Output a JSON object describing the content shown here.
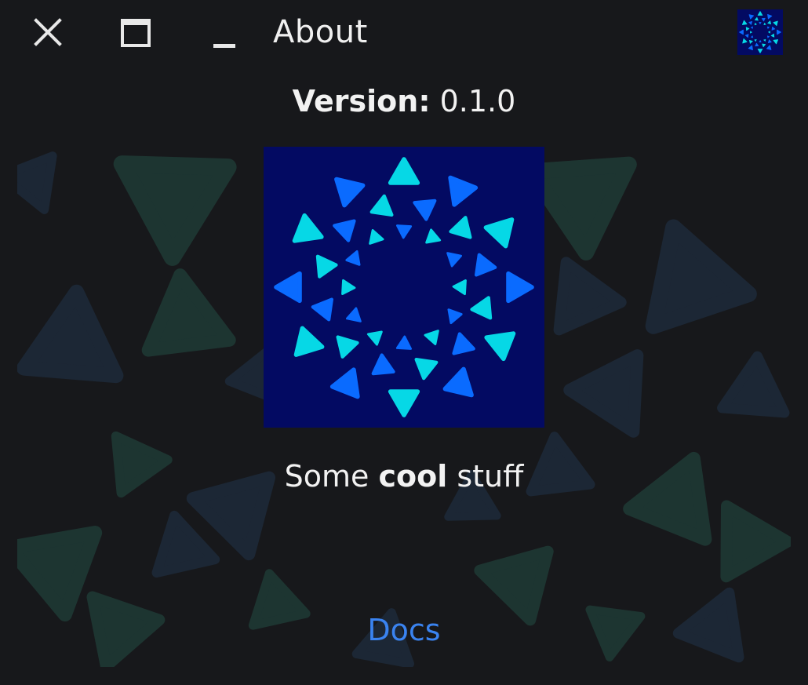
{
  "window": {
    "title": "About",
    "controls": {
      "close_icon": "close-icon",
      "maximize_icon": "maximize-icon",
      "minimize_icon": "minimize-icon"
    },
    "app_icon": "app-logo-icon"
  },
  "about": {
    "version_label": "Version:",
    "version_value": "0.1.0",
    "tagline_prefix": "Some ",
    "tagline_bold": "cool",
    "tagline_suffix": " stuff",
    "docs_link": "Docs"
  },
  "colors": {
    "background": "#17181b",
    "logo_background": "#030a62",
    "logo_cyan": "#06d8e6",
    "logo_blue": "#0a6bff",
    "link": "#3a83f0",
    "pattern_green": "#1f3b36",
    "pattern_blue": "#1d2a3a"
  }
}
